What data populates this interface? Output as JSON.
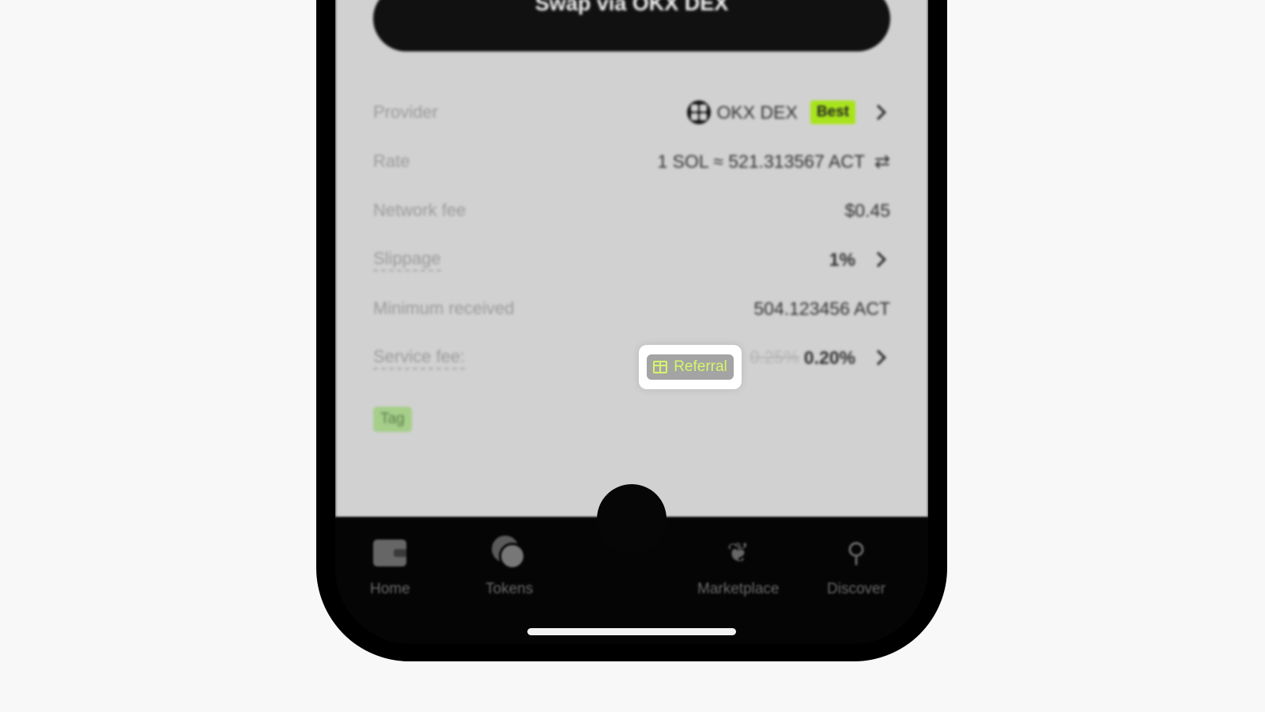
{
  "swap_button": {
    "label": "Swap via OKX DEX"
  },
  "details": {
    "provider": {
      "label": "Provider",
      "value": "OKX DEX",
      "badge": "Best"
    },
    "rate": {
      "label": "Rate",
      "value": "1 SOL ≈ 521.313567 ACT"
    },
    "network_fee": {
      "label": "Network fee",
      "value": "$0.45"
    },
    "slippage": {
      "label": "Slippage",
      "value": "1%"
    },
    "minimum_received": {
      "label": "Minimum received",
      "value": "504.123456 ACT"
    },
    "service_fee": {
      "label": "Service fee:",
      "old_value": "0.25%",
      "value": "0.20%",
      "referral_label": "Referral"
    },
    "tag": "Tag"
  },
  "tabbar": {
    "items": [
      {
        "label": "Home",
        "icon": "wallet-icon"
      },
      {
        "label": "Tokens",
        "icon": "coins-icon"
      },
      {
        "label": "Marketplace",
        "icon": "sprout-icon"
      },
      {
        "label": "Discover",
        "icon": "telescope-icon"
      }
    ]
  },
  "colors": {
    "accent_green": "#a8e41c",
    "referral_text": "#d6f56a",
    "screen_bg": "#d1d1d1"
  }
}
